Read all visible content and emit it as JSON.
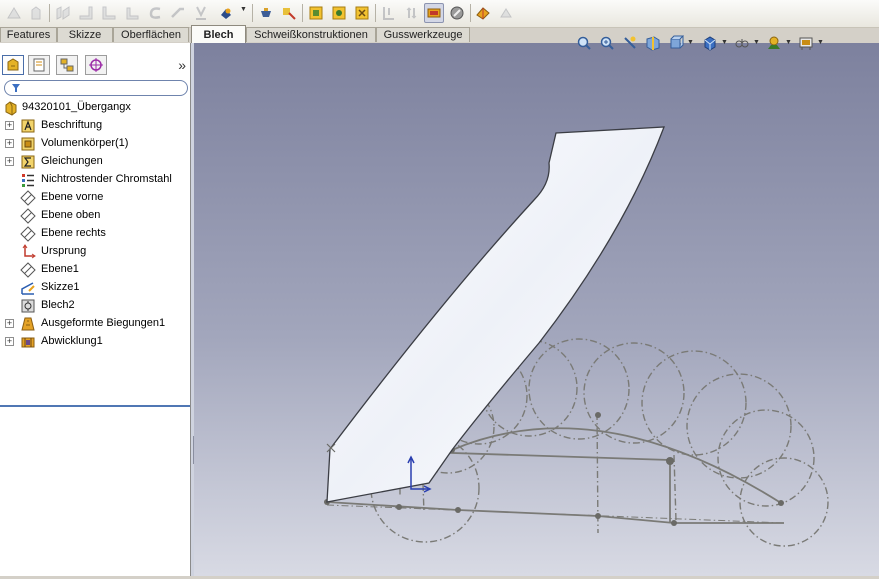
{
  "command_tabs": [
    "Features",
    "Skizze",
    "Oberflächen",
    "Blech",
    "Schweißkonstruktionen",
    "Gusswerkzeuge"
  ],
  "active_tab": "Blech",
  "feature_tree": {
    "root": "94320101_Übergangx",
    "items": [
      {
        "label": "Beschriftung",
        "icon": "annotations-icon",
        "expandable": true
      },
      {
        "label": "Volumenkörper(1)",
        "icon": "solid-bodies-icon",
        "expandable": true
      },
      {
        "label": "Gleichungen",
        "icon": "equations-icon",
        "expandable": true
      },
      {
        "label": "Nichtrostender Chromstahl",
        "icon": "material-icon",
        "expandable": false
      },
      {
        "label": "Ebene vorne",
        "icon": "plane-icon",
        "expandable": false
      },
      {
        "label": "Ebene oben",
        "icon": "plane-icon",
        "expandable": false
      },
      {
        "label": "Ebene rechts",
        "icon": "plane-icon",
        "expandable": false
      },
      {
        "label": "Ursprung",
        "icon": "origin-icon",
        "expandable": false
      },
      {
        "label": "Ebene1",
        "icon": "plane-icon",
        "expandable": false
      },
      {
        "label": "Skizze1",
        "icon": "sketch-icon",
        "expandable": false
      },
      {
        "label": "Blech2",
        "icon": "sheet-metal-icon",
        "expandable": false
      },
      {
        "label": "Ausgeformte Biegungen1",
        "icon": "lofted-bend-icon",
        "expandable": true
      },
      {
        "label": "Abwicklung1",
        "icon": "flatten-icon",
        "expandable": true
      }
    ]
  },
  "panel_more": "»",
  "colors": {
    "viewport_top": "#7d819e",
    "viewport_bottom": "#d8dae4",
    "flat_pattern_fill": "#f4f6fb",
    "sketch_line": "#7a7a76",
    "tree_separator": "#5077b4"
  }
}
